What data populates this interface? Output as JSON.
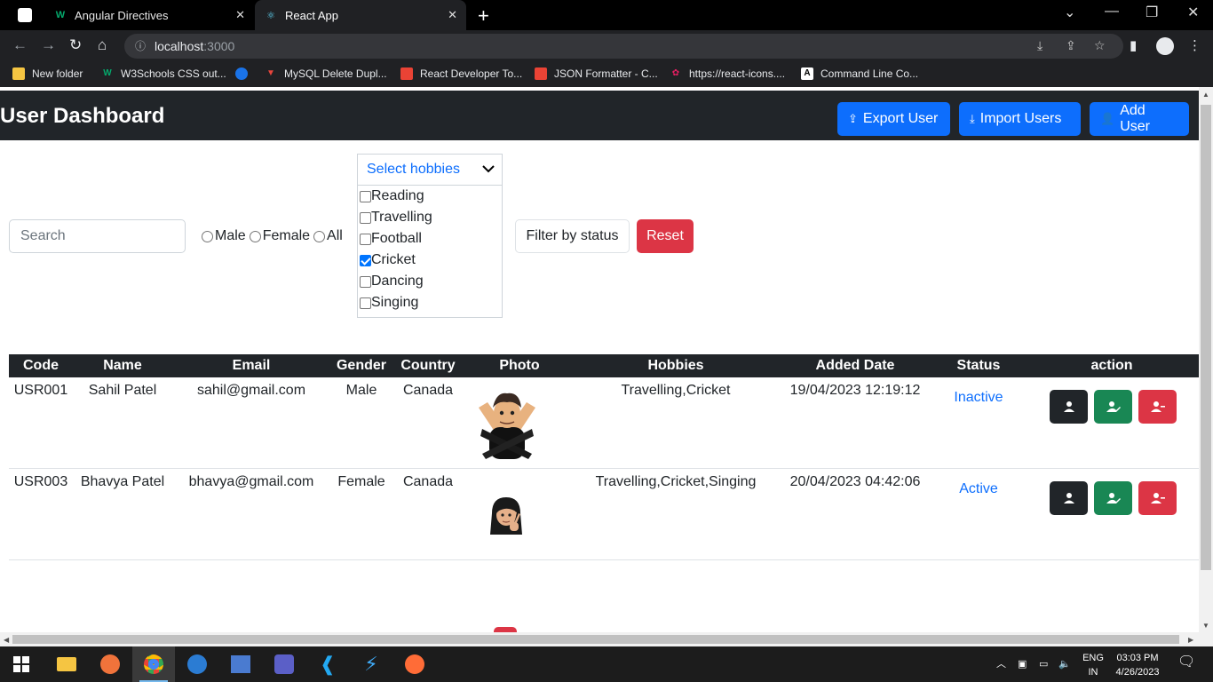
{
  "browser": {
    "tabs": [
      {
        "title": "Angular Directives",
        "active": false
      },
      {
        "title": "React App",
        "active": true
      }
    ],
    "url": {
      "host": "localhost",
      "port": ":3000"
    },
    "bookmarks": [
      "New folder",
      "W3Schools CSS out...",
      "MySQL Delete Dupl...",
      "React Developer To...",
      "JSON Formatter - C...",
      "https://react-icons....",
      "Command Line Co..."
    ]
  },
  "app": {
    "title": "User Dashboard",
    "buttons": {
      "export": "Export User",
      "import": "Import Users",
      "add": "Add User"
    }
  },
  "filters": {
    "search_placeholder": "Search",
    "gender_options": [
      "Male",
      "Female",
      "All"
    ],
    "hobbies_placeholder": "Select hobbies",
    "hobbies": [
      {
        "label": "Reading",
        "checked": false
      },
      {
        "label": "Travelling",
        "checked": false
      },
      {
        "label": "Football",
        "checked": false
      },
      {
        "label": "Cricket",
        "checked": true
      },
      {
        "label": "Dancing",
        "checked": false
      },
      {
        "label": "Singing",
        "checked": false
      }
    ],
    "status_button": "Filter by status",
    "reset_button": "Reset"
  },
  "table": {
    "headers": [
      "Code",
      "Name",
      "Email",
      "Gender",
      "Country",
      "Photo",
      "Hobbies",
      "Added Date",
      "Status",
      "action"
    ],
    "rows": [
      {
        "code": "USR001",
        "name": "Sahil Patel",
        "email": "sahil@gmail.com",
        "gender": "Male",
        "country": "Canada",
        "photo": "memoji-arms-crossed",
        "hobbies": "Travelling,Cricket",
        "added_date": "19/04/2023 12:19:12",
        "status": "Inactive"
      },
      {
        "code": "USR003",
        "name": "Bhavya Patel",
        "email": "bhavya@gmail.com",
        "gender": "Female",
        "country": "Canada",
        "photo": "memoji-peace-sign",
        "hobbies": "Travelling,Cricket,Singing",
        "added_date": "20/04/2023 04:42:06",
        "status": "Active"
      }
    ]
  },
  "taskbar": {
    "lang": "ENG",
    "region": "IN",
    "time": "03:03 PM",
    "date": "4/26/2023"
  },
  "colors": {
    "primary": "#0d6efd",
    "danger": "#dc3545",
    "success": "#198754",
    "dark": "#212529"
  }
}
